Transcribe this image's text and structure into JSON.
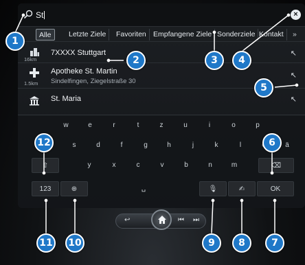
{
  "search": {
    "query": "St"
  },
  "tabs": [
    {
      "label": "Alle",
      "active": true
    },
    {
      "label": "Letzte Ziele",
      "active": false
    },
    {
      "label": "Favoriten",
      "active": false
    },
    {
      "label": "Empfangene Ziele",
      "active": false
    },
    {
      "label": "Sonderziele",
      "active": false
    },
    {
      "label": "Kontakt",
      "active": false
    },
    {
      "label": "»",
      "active": false
    }
  ],
  "results": [
    {
      "icon": "city-icon",
      "distance": "16km",
      "title": "7XXXX Stuttgart",
      "subtitle": ""
    },
    {
      "icon": "pharmacy-cross-icon",
      "distance": "1.5km",
      "title": "Apotheke St. Martin",
      "subtitle": "Sindelfingen, Ziegelstraße 30"
    },
    {
      "icon": "church-icon",
      "distance": "",
      "title": "St. Maria",
      "subtitle": ""
    }
  ],
  "keyboard": {
    "row1": [
      "w",
      "e",
      "r",
      "t",
      "z",
      "u",
      "i",
      "o",
      "p"
    ],
    "row2": [
      "a",
      "s",
      "d",
      "f",
      "g",
      "h",
      "j",
      "k",
      "l",
      "ö",
      "ä"
    ],
    "row3": [
      "y",
      "x",
      "c",
      "v",
      "b",
      "n",
      "m"
    ],
    "shift": "⇧",
    "backspace": "⌫",
    "numbers": "123",
    "space": "␣",
    "ok": "OK"
  },
  "callouts": [
    "1",
    "2",
    "3",
    "4",
    "5",
    "6",
    "7",
    "8",
    "9",
    "10",
    "11",
    "12"
  ],
  "colors": {
    "callout": "#1f78c8",
    "screen": "#1a1d20"
  }
}
